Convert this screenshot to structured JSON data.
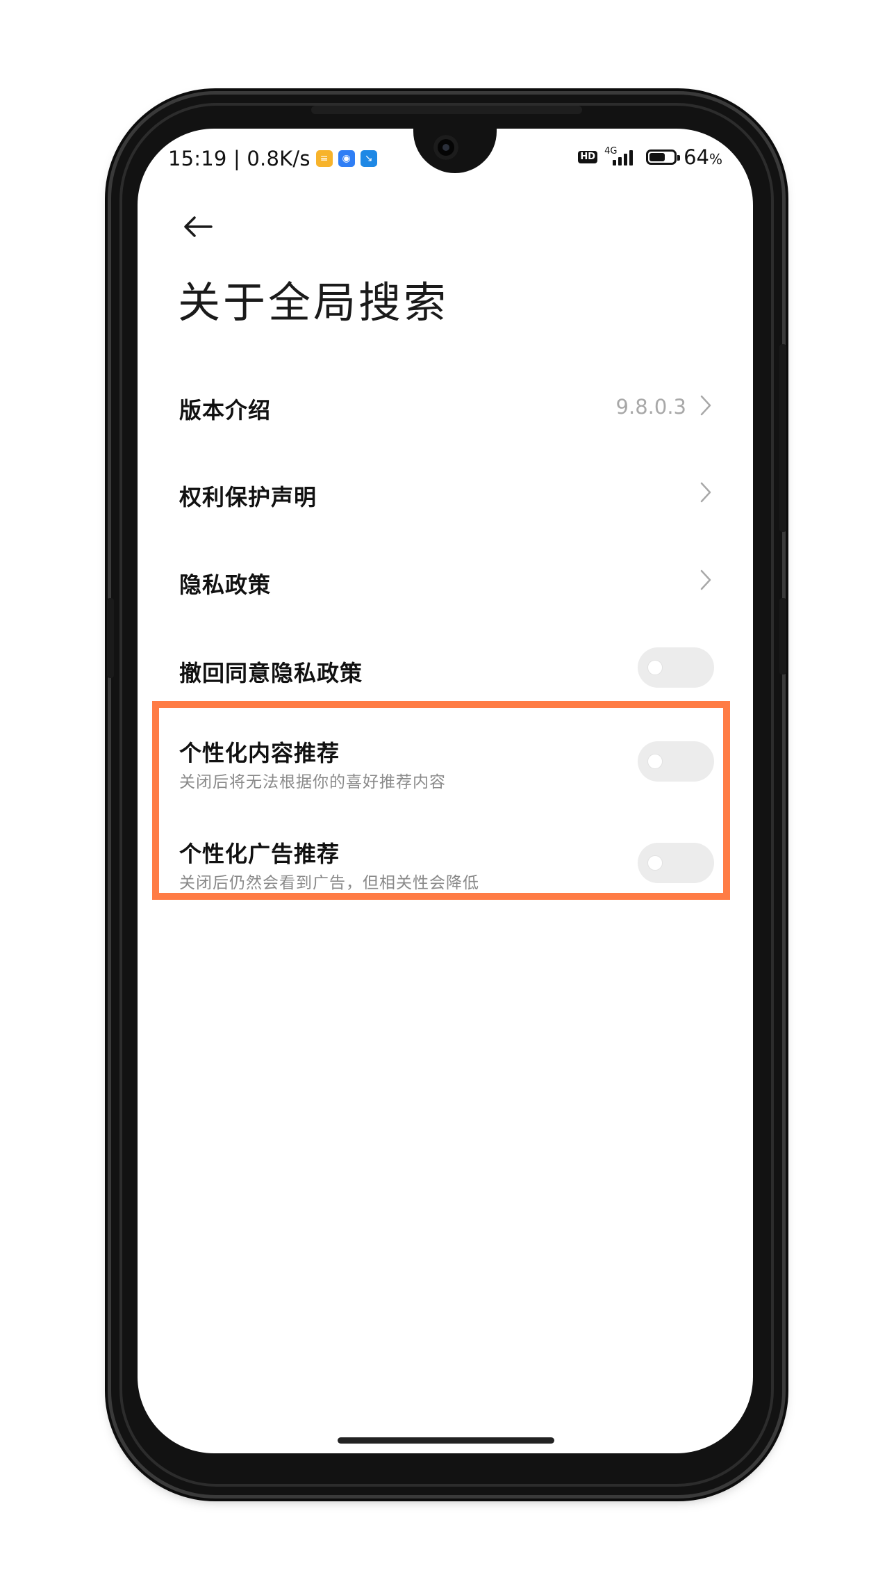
{
  "status_bar": {
    "time": "15:19",
    "separator": "|",
    "speed": "0.8K/s",
    "hd": "HD",
    "network": "4G",
    "battery_percent": "64",
    "battery_unit": "%",
    "battery_level": 0.64
  },
  "header": {
    "title": "关于全局搜索"
  },
  "items": [
    {
      "label": "版本介绍",
      "value": "9.8.0.3",
      "type": "link"
    },
    {
      "label": "权利保护声明",
      "type": "link"
    },
    {
      "label": "隐私政策",
      "type": "link"
    },
    {
      "label": "撤回同意隐私政策",
      "type": "toggle",
      "on": false
    },
    {
      "label": "个性化内容推荐",
      "sub": "关闭后将无法根据你的喜好推荐内容",
      "type": "toggle",
      "on": false
    },
    {
      "label": "个性化广告推荐",
      "sub": "关闭后仍然会看到广告，但相关性会降低",
      "type": "toggle",
      "on": false
    }
  ],
  "colors": {
    "highlight_border": "#ff7c45",
    "toggle_off": "#ececec",
    "text_primary": "#111111",
    "text_secondary": "#8a8a8a"
  }
}
